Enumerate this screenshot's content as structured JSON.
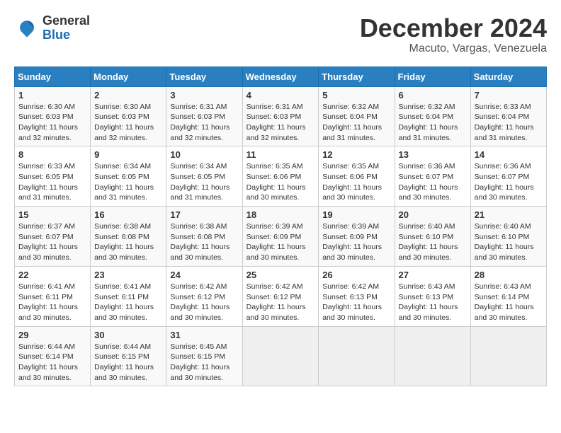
{
  "header": {
    "logo_general": "General",
    "logo_blue": "Blue",
    "title": "December 2024",
    "subtitle": "Macuto, Vargas, Venezuela"
  },
  "calendar": {
    "days_of_week": [
      "Sunday",
      "Monday",
      "Tuesday",
      "Wednesday",
      "Thursday",
      "Friday",
      "Saturday"
    ],
    "weeks": [
      [
        {
          "day": "1",
          "sunrise": "6:30 AM",
          "sunset": "6:03 PM",
          "daylight": "11 hours and 32 minutes."
        },
        {
          "day": "2",
          "sunrise": "6:30 AM",
          "sunset": "6:03 PM",
          "daylight": "11 hours and 32 minutes."
        },
        {
          "day": "3",
          "sunrise": "6:31 AM",
          "sunset": "6:03 PM",
          "daylight": "11 hours and 32 minutes."
        },
        {
          "day": "4",
          "sunrise": "6:31 AM",
          "sunset": "6:03 PM",
          "daylight": "11 hours and 32 minutes."
        },
        {
          "day": "5",
          "sunrise": "6:32 AM",
          "sunset": "6:04 PM",
          "daylight": "11 hours and 31 minutes."
        },
        {
          "day": "6",
          "sunrise": "6:32 AM",
          "sunset": "6:04 PM",
          "daylight": "11 hours and 31 minutes."
        },
        {
          "day": "7",
          "sunrise": "6:33 AM",
          "sunset": "6:04 PM",
          "daylight": "11 hours and 31 minutes."
        }
      ],
      [
        {
          "day": "8",
          "sunrise": "6:33 AM",
          "sunset": "6:05 PM",
          "daylight": "11 hours and 31 minutes."
        },
        {
          "day": "9",
          "sunrise": "6:34 AM",
          "sunset": "6:05 PM",
          "daylight": "11 hours and 31 minutes."
        },
        {
          "day": "10",
          "sunrise": "6:34 AM",
          "sunset": "6:05 PM",
          "daylight": "11 hours and 31 minutes."
        },
        {
          "day": "11",
          "sunrise": "6:35 AM",
          "sunset": "6:06 PM",
          "daylight": "11 hours and 30 minutes."
        },
        {
          "day": "12",
          "sunrise": "6:35 AM",
          "sunset": "6:06 PM",
          "daylight": "11 hours and 30 minutes."
        },
        {
          "day": "13",
          "sunrise": "6:36 AM",
          "sunset": "6:07 PM",
          "daylight": "11 hours and 30 minutes."
        },
        {
          "day": "14",
          "sunrise": "6:36 AM",
          "sunset": "6:07 PM",
          "daylight": "11 hours and 30 minutes."
        }
      ],
      [
        {
          "day": "15",
          "sunrise": "6:37 AM",
          "sunset": "6:07 PM",
          "daylight": "11 hours and 30 minutes."
        },
        {
          "day": "16",
          "sunrise": "6:38 AM",
          "sunset": "6:08 PM",
          "daylight": "11 hours and 30 minutes."
        },
        {
          "day": "17",
          "sunrise": "6:38 AM",
          "sunset": "6:08 PM",
          "daylight": "11 hours and 30 minutes."
        },
        {
          "day": "18",
          "sunrise": "6:39 AM",
          "sunset": "6:09 PM",
          "daylight": "11 hours and 30 minutes."
        },
        {
          "day": "19",
          "sunrise": "6:39 AM",
          "sunset": "6:09 PM",
          "daylight": "11 hours and 30 minutes."
        },
        {
          "day": "20",
          "sunrise": "6:40 AM",
          "sunset": "6:10 PM",
          "daylight": "11 hours and 30 minutes."
        },
        {
          "day": "21",
          "sunrise": "6:40 AM",
          "sunset": "6:10 PM",
          "daylight": "11 hours and 30 minutes."
        }
      ],
      [
        {
          "day": "22",
          "sunrise": "6:41 AM",
          "sunset": "6:11 PM",
          "daylight": "11 hours and 30 minutes."
        },
        {
          "day": "23",
          "sunrise": "6:41 AM",
          "sunset": "6:11 PM",
          "daylight": "11 hours and 30 minutes."
        },
        {
          "day": "24",
          "sunrise": "6:42 AM",
          "sunset": "6:12 PM",
          "daylight": "11 hours and 30 minutes."
        },
        {
          "day": "25",
          "sunrise": "6:42 AM",
          "sunset": "6:12 PM",
          "daylight": "11 hours and 30 minutes."
        },
        {
          "day": "26",
          "sunrise": "6:42 AM",
          "sunset": "6:13 PM",
          "daylight": "11 hours and 30 minutes."
        },
        {
          "day": "27",
          "sunrise": "6:43 AM",
          "sunset": "6:13 PM",
          "daylight": "11 hours and 30 minutes."
        },
        {
          "day": "28",
          "sunrise": "6:43 AM",
          "sunset": "6:14 PM",
          "daylight": "11 hours and 30 minutes."
        }
      ],
      [
        {
          "day": "29",
          "sunrise": "6:44 AM",
          "sunset": "6:14 PM",
          "daylight": "11 hours and 30 minutes."
        },
        {
          "day": "30",
          "sunrise": "6:44 AM",
          "sunset": "6:15 PM",
          "daylight": "11 hours and 30 minutes."
        },
        {
          "day": "31",
          "sunrise": "6:45 AM",
          "sunset": "6:15 PM",
          "daylight": "11 hours and 30 minutes."
        },
        null,
        null,
        null,
        null
      ]
    ]
  }
}
